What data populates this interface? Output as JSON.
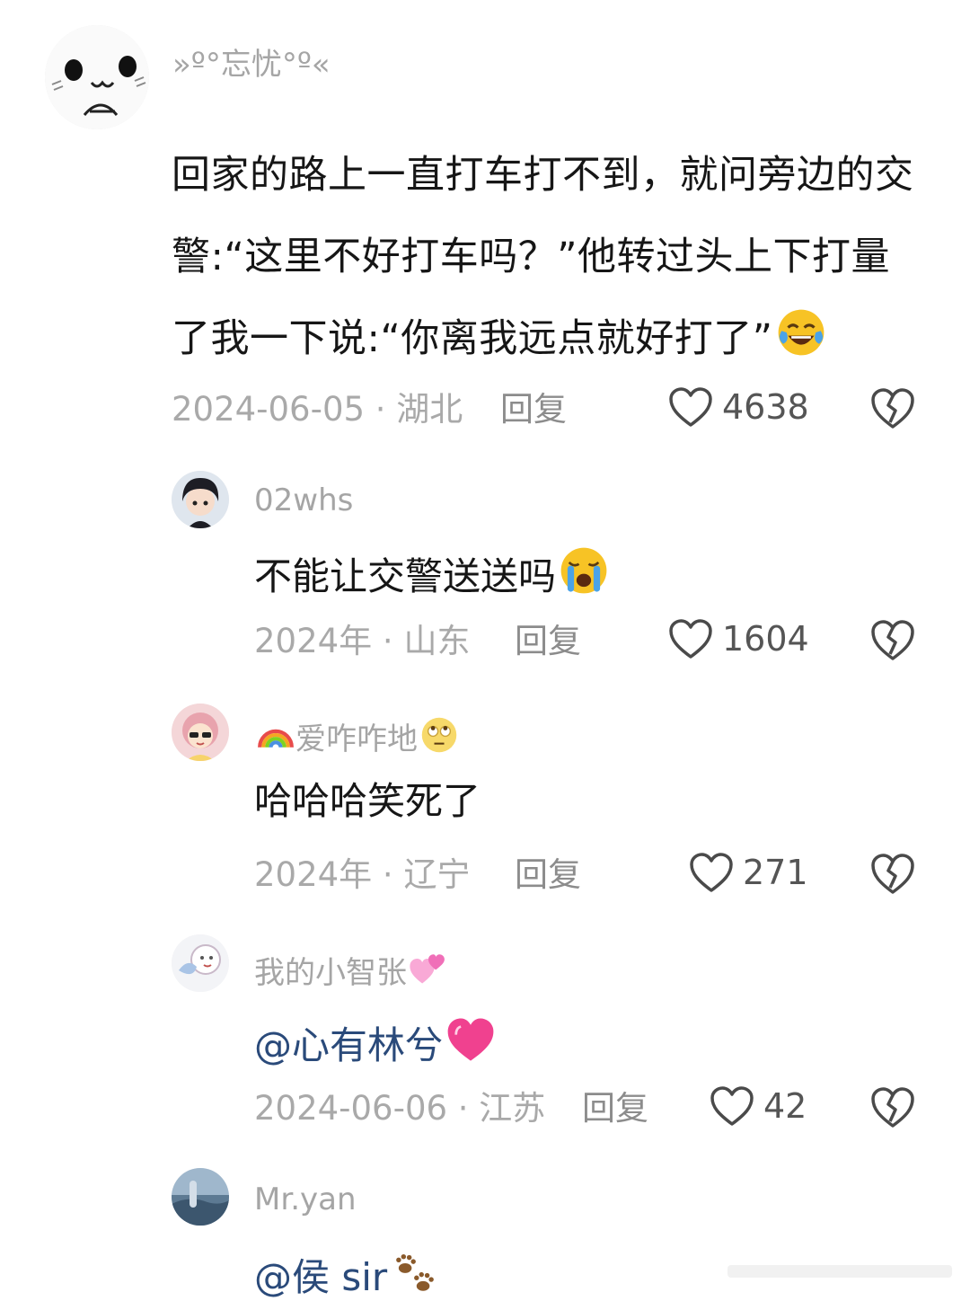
{
  "main_comment": {
    "username": "»º°忘忧°º«",
    "text": "回家的路上一直打车打不到，就问旁边的交警:“这里不好打车吗？”他转过头上下打量了我一下说:“你离我远点就好打了”",
    "emoji": "tears-of-joy-emoji",
    "meta": "2024-06-05 · 湖北",
    "reply_label": "回复",
    "likes": "4638"
  },
  "replies": [
    {
      "username": "02whs",
      "text": "不能让交警送送吗",
      "emoji": "loudly-crying-emoji",
      "meta": "2024年 · 山东",
      "reply_label": "回复",
      "likes": "1604"
    },
    {
      "username": "爱咋咋地",
      "name_prefix_emoji": "rainbow-emoji",
      "name_suffix_emoji": "eye-roll-emoji",
      "text": "哈哈哈笑死了",
      "meta": "2024年 · 辽宁",
      "reply_label": "回复",
      "likes": "271"
    },
    {
      "username": "我的小智张",
      "name_suffix_emoji": "two-hearts-emoji",
      "text": "@心有林兮",
      "emoji": "growing-heart-emoji",
      "meta": "2024-06-06 · 江苏",
      "reply_label": "回复",
      "likes": "42"
    },
    {
      "username": "Mr.yan",
      "text": "@侯 sir",
      "emoji": "paw-prints-emoji"
    }
  ],
  "colors": {
    "text": "#161616",
    "muted": "#a9a9a9",
    "mention": "#2a4a7a"
  }
}
